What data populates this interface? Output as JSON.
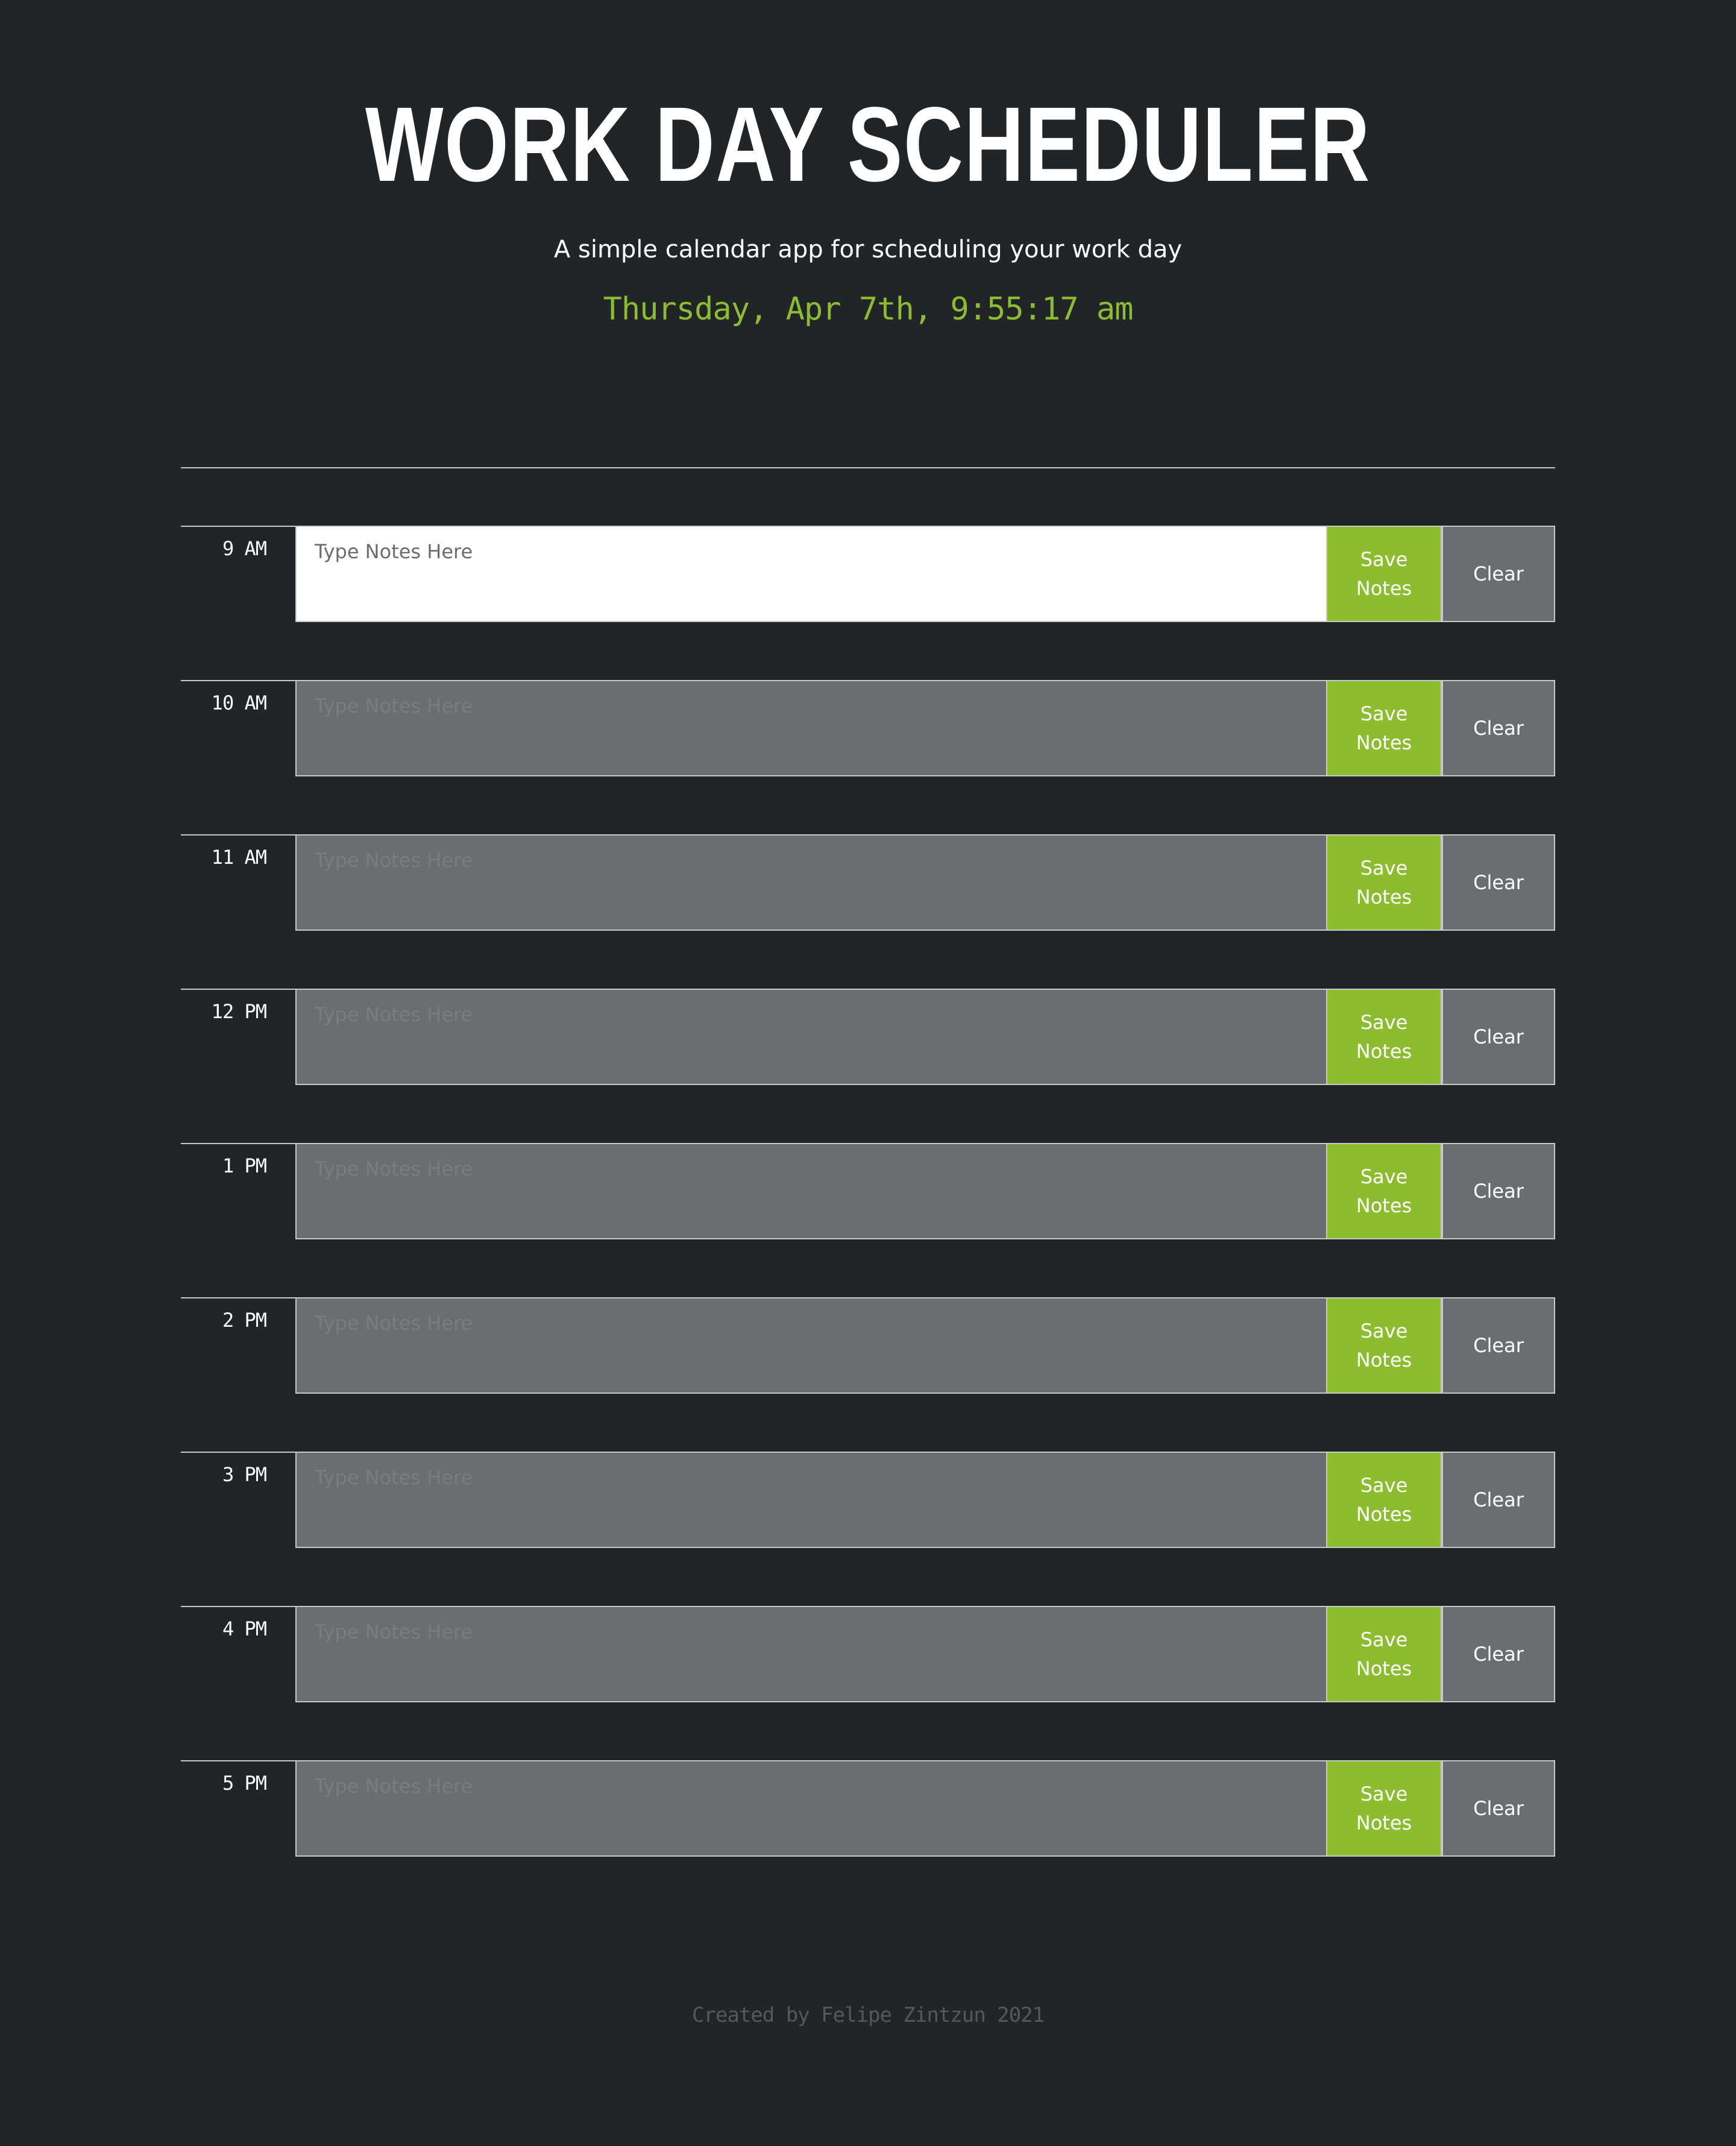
{
  "header": {
    "title": "WORK DAY SCHEDULER",
    "subtitle": "A simple calendar app for scheduling your work day",
    "datetime": "Thursday, Apr 7th, 9:55:17 am"
  },
  "colors": {
    "background": "#222528",
    "accent": "#8bbd2f",
    "future_block": "#6b6e70",
    "present_block": "#ffffff",
    "border": "#c8c8c8"
  },
  "schedule": {
    "note_placeholder": "Type Notes Here",
    "save_label": "Save Notes",
    "clear_label": "Clear",
    "hours": [
      {
        "label": "9 AM",
        "value": "",
        "state": "present"
      },
      {
        "label": "10 AM",
        "value": "",
        "state": "future"
      },
      {
        "label": "11 AM",
        "value": "",
        "state": "future"
      },
      {
        "label": "12 PM",
        "value": "",
        "state": "future"
      },
      {
        "label": "1 PM",
        "value": "",
        "state": "future"
      },
      {
        "label": "2 PM",
        "value": "",
        "state": "future"
      },
      {
        "label": "3 PM",
        "value": "",
        "state": "future"
      },
      {
        "label": "4 PM",
        "value": "",
        "state": "future"
      },
      {
        "label": "5 PM",
        "value": "",
        "state": "future"
      }
    ]
  },
  "footer": {
    "credit": "Created by Felipe Zintzun 2021"
  }
}
